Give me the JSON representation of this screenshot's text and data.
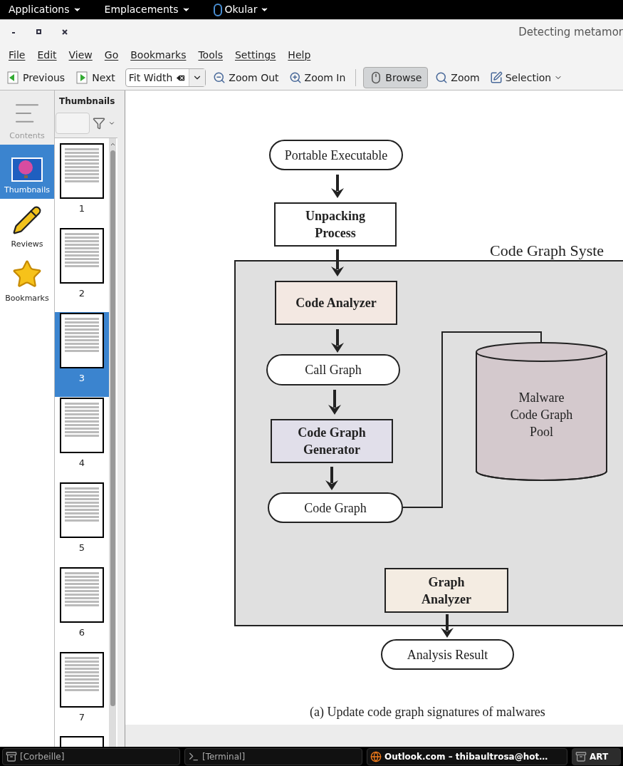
{
  "top_panel": {
    "menus": [
      "Applications",
      "Emplacements",
      "Okular"
    ]
  },
  "window": {
    "title": "Detecting metamor"
  },
  "menu_bar": [
    "File",
    "Edit",
    "View",
    "Go",
    "Bookmarks",
    "Tools",
    "Settings",
    "Help"
  ],
  "toolbar": {
    "items": [
      {
        "kind": "button",
        "label": "Previous",
        "selected": false
      },
      {
        "kind": "button",
        "label": "Next",
        "selected": false
      },
      {
        "kind": "combo",
        "label": "Fit Width"
      },
      {
        "kind": "button",
        "label": "Zoom Out",
        "selected": false
      },
      {
        "kind": "button",
        "label": "Zoom In",
        "selected": false
      },
      {
        "kind": "separator"
      },
      {
        "kind": "button",
        "label": "Browse",
        "selected": true
      },
      {
        "kind": "button",
        "label": "Zoom",
        "selected": false
      },
      {
        "kind": "menu",
        "label": "Selection",
        "selected": false
      }
    ]
  },
  "sidebar": {
    "items": [
      {
        "label": "Contents",
        "selected": false,
        "disabled": true
      },
      {
        "label": "Thumbnails",
        "selected": true,
        "disabled": false
      },
      {
        "label": "Reviews",
        "selected": false,
        "disabled": false
      },
      {
        "label": "Bookmarks",
        "selected": false,
        "disabled": false
      }
    ]
  },
  "thumbnails": {
    "title": "Thumbnails",
    "pages": [
      {
        "label": "1",
        "selected": false
      },
      {
        "label": "2",
        "selected": false
      },
      {
        "label": "3",
        "selected": true
      },
      {
        "label": "4",
        "selected": false
      },
      {
        "label": "5",
        "selected": false
      },
      {
        "label": "6",
        "selected": false
      },
      {
        "label": "7",
        "selected": false
      }
    ]
  },
  "diagram": {
    "system_title": "Code Graph Syste",
    "nodes": [
      {
        "kind": "pill",
        "label": "Portable Executable"
      },
      {
        "kind": "box",
        "label": "Unpacking Process",
        "color": "#ffffff"
      },
      {
        "kind": "box",
        "label": "Code Analyzer",
        "color": "#f3e8e2"
      },
      {
        "kind": "pill",
        "label": "Call Graph"
      },
      {
        "kind": "box",
        "label": "Code Graph Generator",
        "color": "#e1dfea"
      },
      {
        "kind": "pill",
        "label": "Code Graph"
      },
      {
        "kind": "cylinder",
        "label": "Malware Code Graph Pool",
        "color": "#d4c9cd"
      },
      {
        "kind": "box",
        "label": "Graph Analyzer",
        "color": "#f4ece2"
      },
      {
        "kind": "pill",
        "label": "Analysis Result"
      }
    ],
    "caption": "(a) Update code graph signatures of malwares"
  },
  "taskbar": [
    {
      "label": "[Corbeille]",
      "selected": false
    },
    {
      "label": "[Terminal]",
      "selected": false
    },
    {
      "label": "Outlook.com – thibaultrosa@hot…",
      "selected": false
    },
    {
      "label": "ART",
      "selected": true
    }
  ]
}
